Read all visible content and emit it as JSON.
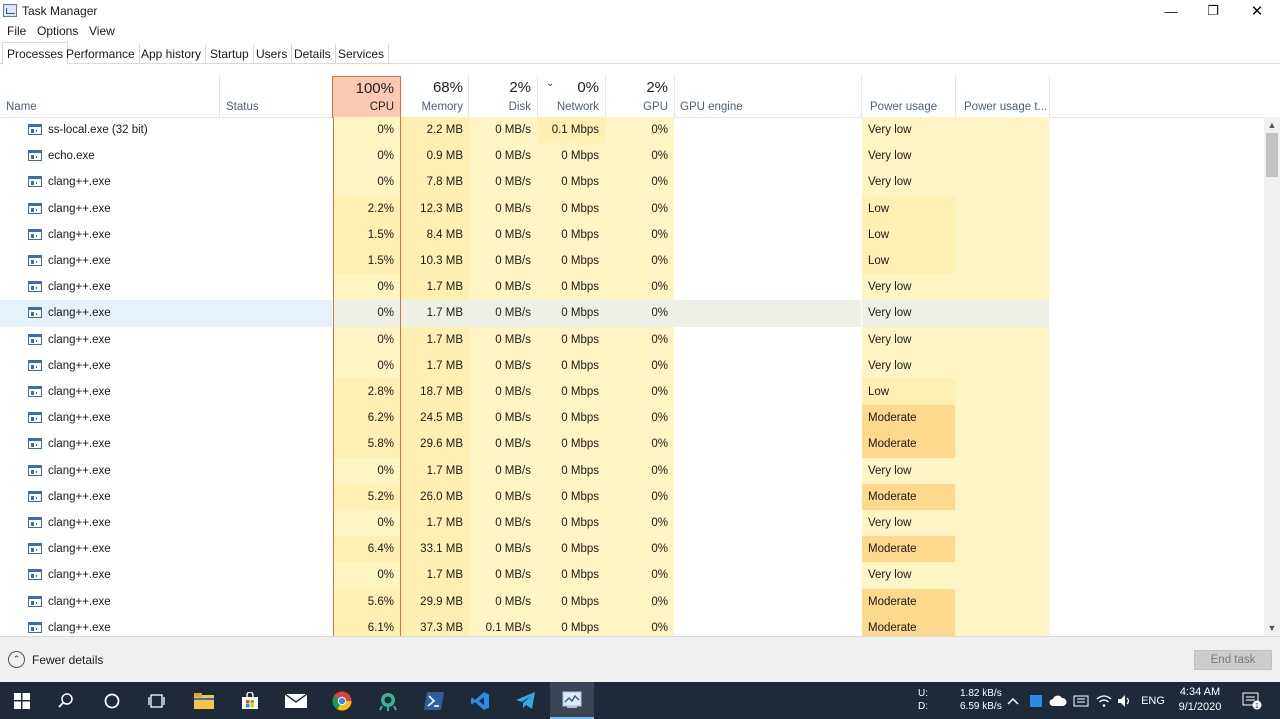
{
  "window": {
    "title": "Task Manager",
    "min_glyph": "—",
    "max_glyph": "❐",
    "close_glyph": "✕"
  },
  "menu": [
    "File",
    "Options",
    "View"
  ],
  "tabs": [
    "Processes",
    "Performance",
    "App history",
    "Startup",
    "Users",
    "Details",
    "Services"
  ],
  "active_tab": "Processes",
  "header": {
    "name": "Name",
    "status": "Status",
    "cpu": {
      "pct": "100%",
      "label": "CPU"
    },
    "memory": {
      "pct": "68%",
      "label": "Memory"
    },
    "disk": {
      "pct": "2%",
      "label": "Disk"
    },
    "network": {
      "pct": "0%",
      "label": "Network",
      "sort": "⌄"
    },
    "gpu": {
      "pct": "2%",
      "label": "GPU"
    },
    "gpu_engine": "GPU engine",
    "power": "Power usage",
    "power_trend": "Power usage t..."
  },
  "processes": [
    {
      "name": "ss-local.exe (32 bit)",
      "cpu": "0%",
      "mem": "2.2 MB",
      "disk": "0 MB/s",
      "net": "0.1 Mbps",
      "gpu": "0%",
      "power": "Very low",
      "cpu_heat": 0,
      "mem_heat": 1,
      "net_heat": 1,
      "power_heat": 0
    },
    {
      "name": "echo.exe",
      "cpu": "0%",
      "mem": "0.9 MB",
      "disk": "0 MB/s",
      "net": "0 Mbps",
      "gpu": "0%",
      "power": "Very low",
      "cpu_heat": 0,
      "mem_heat": 1,
      "net_heat": 0,
      "power_heat": 0
    },
    {
      "name": "clang++.exe",
      "cpu": "0%",
      "mem": "7.8 MB",
      "disk": "0 MB/s",
      "net": "0 Mbps",
      "gpu": "0%",
      "power": "Very low",
      "cpu_heat": 0,
      "mem_heat": 1,
      "net_heat": 0,
      "power_heat": 0
    },
    {
      "name": "clang++.exe",
      "cpu": "2.2%",
      "mem": "12.3 MB",
      "disk": "0 MB/s",
      "net": "0 Mbps",
      "gpu": "0%",
      "power": "Low",
      "cpu_heat": 1,
      "mem_heat": 1,
      "net_heat": 0,
      "power_heat": 1
    },
    {
      "name": "clang++.exe",
      "cpu": "1.5%",
      "mem": "8.4 MB",
      "disk": "0 MB/s",
      "net": "0 Mbps",
      "gpu": "0%",
      "power": "Low",
      "cpu_heat": 1,
      "mem_heat": 1,
      "net_heat": 0,
      "power_heat": 1
    },
    {
      "name": "clang++.exe",
      "cpu": "1.5%",
      "mem": "10.3 MB",
      "disk": "0 MB/s",
      "net": "0 Mbps",
      "gpu": "0%",
      "power": "Low",
      "cpu_heat": 1,
      "mem_heat": 1,
      "net_heat": 0,
      "power_heat": 1
    },
    {
      "name": "clang++.exe",
      "cpu": "0%",
      "mem": "1.7 MB",
      "disk": "0 MB/s",
      "net": "0 Mbps",
      "gpu": "0%",
      "power": "Very low",
      "cpu_heat": 0,
      "mem_heat": 1,
      "net_heat": 0,
      "power_heat": 0
    },
    {
      "name": "clang++.exe",
      "cpu": "0%",
      "mem": "1.7 MB",
      "disk": "0 MB/s",
      "net": "0 Mbps",
      "gpu": "0%",
      "power": "Very low",
      "cpu_heat": 0,
      "mem_heat": 1,
      "net_heat": 0,
      "power_heat": 0,
      "selected": true
    },
    {
      "name": "clang++.exe",
      "cpu": "0%",
      "mem": "1.7 MB",
      "disk": "0 MB/s",
      "net": "0 Mbps",
      "gpu": "0%",
      "power": "Very low",
      "cpu_heat": 0,
      "mem_heat": 1,
      "net_heat": 0,
      "power_heat": 0
    },
    {
      "name": "clang++.exe",
      "cpu": "0%",
      "mem": "1.7 MB",
      "disk": "0 MB/s",
      "net": "0 Mbps",
      "gpu": "0%",
      "power": "Very low",
      "cpu_heat": 0,
      "mem_heat": 1,
      "net_heat": 0,
      "power_heat": 0
    },
    {
      "name": "clang++.exe",
      "cpu": "2.8%",
      "mem": "18.7 MB",
      "disk": "0 MB/s",
      "net": "0 Mbps",
      "gpu": "0%",
      "power": "Low",
      "cpu_heat": 1,
      "mem_heat": 1,
      "net_heat": 0,
      "power_heat": 1
    },
    {
      "name": "clang++.exe",
      "cpu": "6.2%",
      "mem": "24.5 MB",
      "disk": "0 MB/s",
      "net": "0 Mbps",
      "gpu": "0%",
      "power": "Moderate",
      "cpu_heat": 1,
      "mem_heat": 1,
      "net_heat": 0,
      "power_heat": 2
    },
    {
      "name": "clang++.exe",
      "cpu": "5.8%",
      "mem": "29.6 MB",
      "disk": "0 MB/s",
      "net": "0 Mbps",
      "gpu": "0%",
      "power": "Moderate",
      "cpu_heat": 1,
      "mem_heat": 1,
      "net_heat": 0,
      "power_heat": 2
    },
    {
      "name": "clang++.exe",
      "cpu": "0%",
      "mem": "1.7 MB",
      "disk": "0 MB/s",
      "net": "0 Mbps",
      "gpu": "0%",
      "power": "Very low",
      "cpu_heat": 0,
      "mem_heat": 1,
      "net_heat": 0,
      "power_heat": 0
    },
    {
      "name": "clang++.exe",
      "cpu": "5.2%",
      "mem": "26.0 MB",
      "disk": "0 MB/s",
      "net": "0 Mbps",
      "gpu": "0%",
      "power": "Moderate",
      "cpu_heat": 1,
      "mem_heat": 1,
      "net_heat": 0,
      "power_heat": 2
    },
    {
      "name": "clang++.exe",
      "cpu": "0%",
      "mem": "1.7 MB",
      "disk": "0 MB/s",
      "net": "0 Mbps",
      "gpu": "0%",
      "power": "Very low",
      "cpu_heat": 0,
      "mem_heat": 1,
      "net_heat": 0,
      "power_heat": 0
    },
    {
      "name": "clang++.exe",
      "cpu": "6.4%",
      "mem": "33.1 MB",
      "disk": "0 MB/s",
      "net": "0 Mbps",
      "gpu": "0%",
      "power": "Moderate",
      "cpu_heat": 1,
      "mem_heat": 1,
      "net_heat": 0,
      "power_heat": 2
    },
    {
      "name": "clang++.exe",
      "cpu": "0%",
      "mem": "1.7 MB",
      "disk": "0 MB/s",
      "net": "0 Mbps",
      "gpu": "0%",
      "power": "Very low",
      "cpu_heat": 0,
      "mem_heat": 1,
      "net_heat": 0,
      "power_heat": 0
    },
    {
      "name": "clang++.exe",
      "cpu": "5.6%",
      "mem": "29.9 MB",
      "disk": "0 MB/s",
      "net": "0 Mbps",
      "gpu": "0%",
      "power": "Moderate",
      "cpu_heat": 1,
      "mem_heat": 1,
      "net_heat": 0,
      "power_heat": 2
    },
    {
      "name": "clang++.exe",
      "cpu": "6.1%",
      "mem": "37.3 MB",
      "disk": "0.1 MB/s",
      "net": "0 Mbps",
      "gpu": "0%",
      "power": "Moderate",
      "cpu_heat": 1,
      "mem_heat": 1,
      "net_heat": 0,
      "power_heat": 2
    }
  ],
  "footer": {
    "fewer_details": "Fewer details",
    "end_task": "End task"
  },
  "taskbar": {
    "net_up_label": "U:",
    "net_up": "1.82 kB/s",
    "net_down_label": "D:",
    "net_down": "6.59 kB/s",
    "lang": "ENG",
    "time": "4:34 AM",
    "date": "9/1/2020",
    "notif_count": "1"
  },
  "colors": {
    "cpu_header": "#f9c9b3",
    "cpu_border": "#e8703a",
    "heat_low": "#fff4c4",
    "heat_mid": "#ffefb1",
    "heat_high": "#fcd98c",
    "selected_row": "#e5f1fb",
    "taskbar": "#1f2a38"
  }
}
